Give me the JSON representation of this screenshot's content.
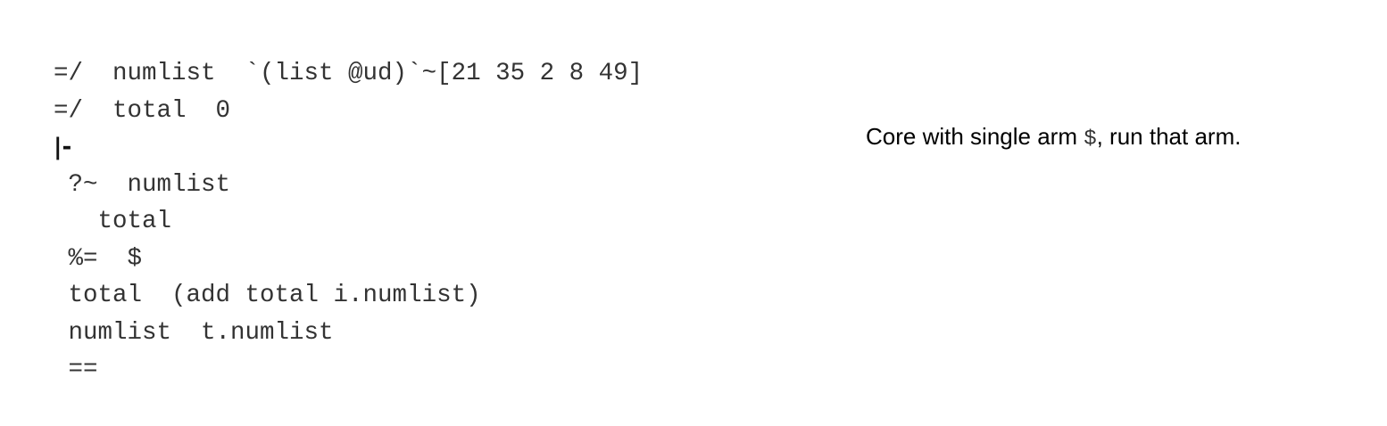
{
  "code": {
    "lines": [
      "=/  numlist  `(list @ud)`~[21 35 2 8 49]",
      "=/  total  0",
      "|-",
      " ?~  numlist",
      "   total",
      " %=  $",
      " total  (add total i.numlist)",
      " numlist  t.numlist",
      " =="
    ]
  },
  "annotation": {
    "before": "Core with single arm ",
    "rune": "$",
    "after": ", run that arm."
  }
}
